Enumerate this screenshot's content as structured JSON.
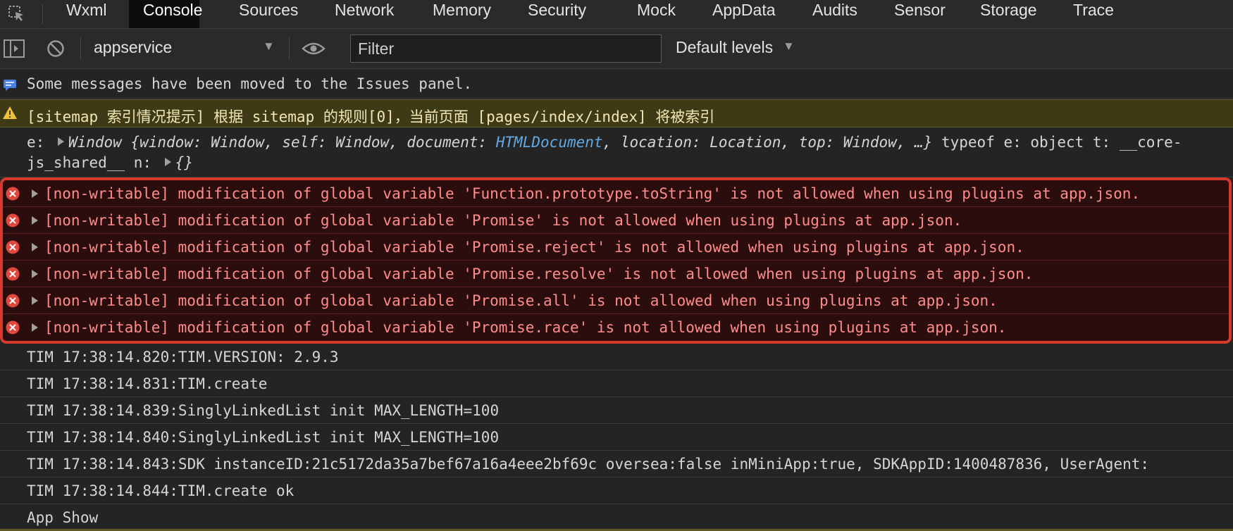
{
  "tabs": [
    {
      "label": "Wxml",
      "active": false
    },
    {
      "label": "Console",
      "active": true
    },
    {
      "label": "Sources",
      "active": false
    },
    {
      "label": "Network",
      "active": false
    },
    {
      "label": "Memory",
      "active": false
    },
    {
      "label": "Security",
      "active": false
    },
    {
      "label": "Mock",
      "active": false
    },
    {
      "label": "AppData",
      "active": false
    },
    {
      "label": "Audits",
      "active": false
    },
    {
      "label": "Sensor",
      "active": false
    },
    {
      "label": "Storage",
      "active": false
    },
    {
      "label": "Trace",
      "active": false
    }
  ],
  "toolbar": {
    "context": "appservice",
    "filter_placeholder": "Filter",
    "levels": "Default levels"
  },
  "console": {
    "info": "Some messages have been moved to the Issues panel.",
    "warning": "[sitemap 索引情况提示] 根据 sitemap 的规则[0]，当前页面 [pages/index/index] 将被索引",
    "object_log": {
      "l1_prefix": "e:",
      "l1_obj_a": "Window {window: Window, self: Window, document: ",
      "l1_link": "HTMLDocument",
      "l1_obj_b": ", location: Location, top: Window, …}",
      "l1_suffix": " typeof e: object t: __core-",
      "l2_prefix": "js_shared__ n:",
      "l2_obj": "{}"
    },
    "errors": [
      "[non-writable] modification of global variable 'Function.prototype.toString' is not allowed when using plugins at app.json.",
      "[non-writable] modification of global variable 'Promise' is not allowed when using plugins at app.json.",
      "[non-writable] modification of global variable 'Promise.reject' is not allowed when using plugins at app.json.",
      "[non-writable] modification of global variable 'Promise.resolve' is not allowed when using plugins at app.json.",
      "[non-writable] modification of global variable 'Promise.all' is not allowed when using plugins at app.json.",
      "[non-writable] modification of global variable 'Promise.race' is not allowed when using plugins at app.json."
    ],
    "logs": [
      "TIM 17:38:14.820:TIM.VERSION: 2.9.3",
      "TIM 17:38:14.831:TIM.create",
      "TIM 17:38:14.839:SinglyLinkedList init MAX_LENGTH=100",
      "TIM 17:38:14.840:SinglyLinkedList init MAX_LENGTH=100",
      "TIM 17:38:14.843:SDK instanceID:21c5172da35a7bef67a16a4eee2bf69c oversea:false inMiniApp:true, SDKAppID:1400487836, UserAgent:",
      "TIM 17:38:14.844:TIM.create ok",
      "App Show"
    ]
  },
  "colors": {
    "background": "#242424",
    "error_text": "#ff8c8c",
    "error_icon": "#e0483e",
    "warning_bg": "#3d3a15",
    "warning_icon": "#f0c23b",
    "info_icon": "#4a7fe0",
    "highlight_border": "#d63a2c",
    "link": "#62a9e3"
  }
}
